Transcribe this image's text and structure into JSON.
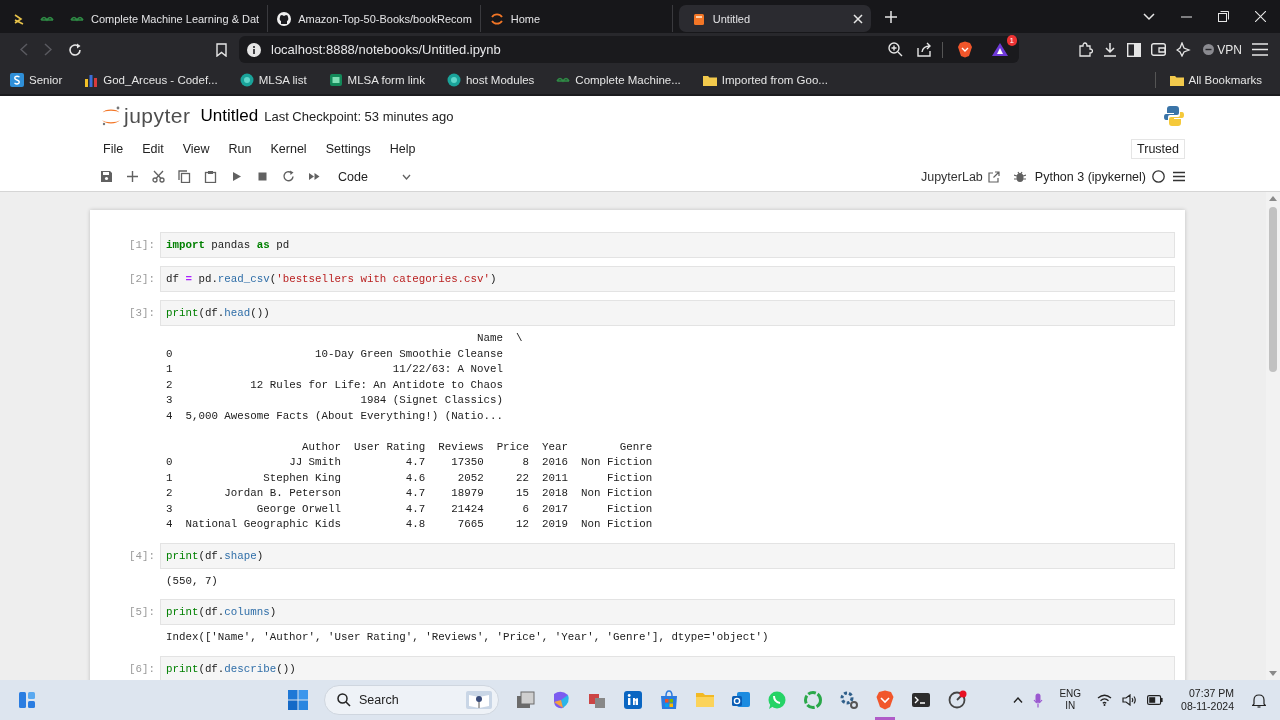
{
  "browser": {
    "tabs": [
      {
        "kind": "pinned",
        "selected": false
      },
      {
        "kind": "pinned",
        "selected": false
      },
      {
        "kind": "page",
        "title": "Complete Machine Learning & Dat",
        "selected": false
      },
      {
        "kind": "page",
        "title": "Amazon-Top-50-Books/bookRecom",
        "selected": false
      },
      {
        "kind": "page",
        "title": "Home",
        "selected": false
      },
      {
        "kind": "page",
        "title": "Untitled",
        "selected": true
      }
    ],
    "address": "localhost:8888/notebooks/Untitled.ipynb",
    "alert_badge": "1",
    "vpn_label": "VPN",
    "bookmarks": [
      "Senior",
      "God_Arceus - Codef...",
      "MLSA list",
      "MLSA form link",
      "host Modules",
      "Complete Machine...",
      "Imported from Goo..."
    ],
    "all_bookmarks": "All Bookmarks"
  },
  "jupyter": {
    "logo_text": "jupyter",
    "title": "Untitled",
    "checkpoint": "Last Checkpoint: 53 minutes ago",
    "menu": [
      "File",
      "Edit",
      "View",
      "Run",
      "Kernel",
      "Settings",
      "Help"
    ],
    "trusted": "Trusted",
    "cell_type": "Code",
    "lab_link": "JupyterLab",
    "kernel": "Python 3 (ipykernel)"
  },
  "cells": [
    {
      "prompt": "[1]:",
      "code": [
        {
          "kind": "keyword",
          "text": "import"
        },
        {
          "kind": "plain",
          "text": " pandas "
        },
        {
          "kind": "keyword",
          "text": "as"
        },
        {
          "kind": "plain",
          "text": " pd"
        }
      ]
    },
    {
      "prompt": "[2]:",
      "code": [
        {
          "kind": "plain",
          "text": "df "
        },
        {
          "kind": "operator",
          "text": "="
        },
        {
          "kind": "plain",
          "text": " pd."
        },
        {
          "kind": "method",
          "text": "read_csv"
        },
        {
          "kind": "plain",
          "text": "("
        },
        {
          "kind": "string",
          "text": "'bestsellers with categories.csv'"
        },
        {
          "kind": "plain",
          "text": ")"
        }
      ]
    },
    {
      "prompt": "[3]:",
      "code": [
        {
          "kind": "builtin",
          "text": "print"
        },
        {
          "kind": "plain",
          "text": "(df."
        },
        {
          "kind": "method",
          "text": "head"
        },
        {
          "kind": "plain",
          "text": "())"
        }
      ],
      "output": [
        {
          "kind": "table",
          "columns": [
            "Name",
            "\\"
          ],
          "rows": [
            {
              "index": "0",
              "cells": [
                "10-Day Green Smoothie Cleanse"
              ]
            },
            {
              "index": "1",
              "cells": [
                "11/22/63: A Novel"
              ]
            },
            {
              "index": "2",
              "cells": [
                "12 Rules for Life: An Antidote to Chaos"
              ]
            },
            {
              "index": "3",
              "cells": [
                "1984 (Signet Classics)"
              ]
            },
            {
              "index": "4",
              "cells": [
                "5,000 Awesome Facts (About Everything!) (Natio..."
              ]
            }
          ]
        },
        {
          "kind": "table",
          "columns": [
            "Author",
            "User Rating",
            "Reviews",
            "Price",
            "Year",
            "Genre"
          ],
          "rows": [
            {
              "index": "0",
              "cells": [
                "JJ Smith",
                "4.7",
                "17350",
                "8",
                "2016",
                "Non Fiction"
              ]
            },
            {
              "index": "1",
              "cells": [
                "Stephen King",
                "4.6",
                "2052",
                "22",
                "2011",
                "Fiction"
              ]
            },
            {
              "index": "2",
              "cells": [
                "Jordan B. Peterson",
                "4.7",
                "18979",
                "15",
                "2018",
                "Non Fiction"
              ]
            },
            {
              "index": "3",
              "cells": [
                "George Orwell",
                "4.7",
                "21424",
                "6",
                "2017",
                "Fiction"
              ]
            },
            {
              "index": "4",
              "cells": [
                "National Geographic Kids",
                "4.8",
                "7665",
                "12",
                "2019",
                "Non Fiction"
              ]
            }
          ]
        }
      ]
    },
    {
      "prompt": "[4]:",
      "code": [
        {
          "kind": "builtin",
          "text": "print"
        },
        {
          "kind": "plain",
          "text": "(df."
        },
        {
          "kind": "method",
          "text": "shape"
        },
        {
          "kind": "plain",
          "text": ")"
        }
      ],
      "output": [
        {
          "kind": "text",
          "text": "(550, 7)"
        }
      ]
    },
    {
      "prompt": "[5]:",
      "code": [
        {
          "kind": "builtin",
          "text": "print"
        },
        {
          "kind": "plain",
          "text": "(df."
        },
        {
          "kind": "method",
          "text": "columns"
        },
        {
          "kind": "plain",
          "text": ")"
        }
      ],
      "output": [
        {
          "kind": "text",
          "text": "Index(['Name', 'Author', 'User Rating', 'Reviews', 'Price', 'Year', 'Genre'], dtype='object')"
        }
      ]
    },
    {
      "prompt": "[6]:",
      "code": [
        {
          "kind": "builtin",
          "text": "print"
        },
        {
          "kind": "plain",
          "text": "(df."
        },
        {
          "kind": "method",
          "text": "describe"
        },
        {
          "kind": "plain",
          "text": "())"
        }
      ]
    }
  ],
  "taskbar": {
    "search": "Search",
    "language": "ENG",
    "region": "IN",
    "time": "07:37 PM",
    "date": "08-11-2024"
  }
}
